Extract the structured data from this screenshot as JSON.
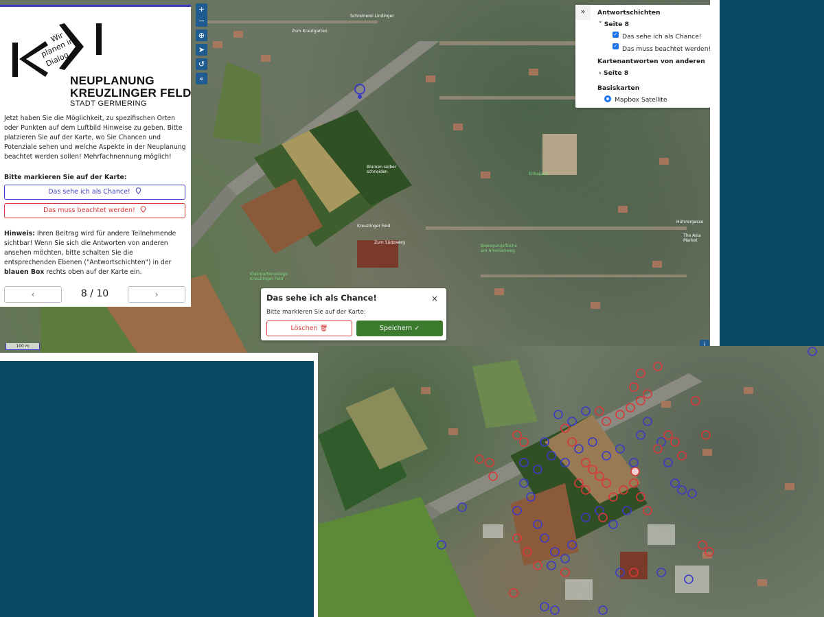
{
  "logo": {
    "words": [
      "Wir",
      "planen im",
      "Dialog"
    ],
    "title_line1": "NEUPLANUNG",
    "title_line2": "KREUZLINGER FELD",
    "title_line3": "STADT GERMERING"
  },
  "panel": {
    "intro": "Jetzt haben Sie die Möglichkeit, zu spezifischen Orten oder Punkten auf dem Luftbild Hinweise zu geben. Bitte platzieren Sie auf der Karte, wo Sie Chancen und Potenziale sehen und welche Aspekte in der Neuplanung beachtet werden sollen! Mehrfachnennung möglich!",
    "mark_heading": "Bitte markieren Sie auf der Karte:",
    "btn_chance": "Das sehe ich als Chance!",
    "btn_attention": "Das muss beachtet werden!",
    "hint_label": "Hinweis:",
    "hint_text_1": " Ihren Beitrag wird für andere Teilnehmende sichtbar! Wenn Sie sich die Antworten von anderen ansehen möchten, bitte schalten Sie die entsprechenden Ebenen (\"Antwortschichten\") in der ",
    "hint_bold": "blauen Box",
    "hint_text_2": " rechts oben auf der Karte ein.",
    "page": "8 / 10"
  },
  "layers": {
    "heading_answers": "Antwortschichten",
    "group_page": "Seite 8",
    "item_chance": "Das sehe ich als Chance!",
    "item_attention": "Das muss beachtet werden!",
    "heading_others": "Kartenantworten von anderen",
    "others_page": "Seite 8",
    "heading_base": "Basiskarten",
    "base_item": "Mapbox Satellite",
    "toggle": "»"
  },
  "popup": {
    "title": "Das sehe ich als Chance!",
    "subtitle": "Bitte markieren Sie auf der Karte:",
    "delete": "Löschen",
    "save": "Speichern",
    "close": "×"
  },
  "map": {
    "scale": "100 m",
    "labels": [
      "Zum Krautgarten",
      "Schreinerei Lindinger",
      "Blumen selber schneiden",
      "Zum Südzwerg",
      "Kreuzlinger Feld",
      "Erikapark",
      "Bewegungsfläche am Ameisenweg",
      "Kleingartenanlage Kreuzlinger Feld",
      "Hühnergasse",
      "The Asia Market"
    ],
    "info": "i"
  },
  "colors": {
    "chance": "#3b3bc4",
    "attention": "#d93838",
    "save": "#3c7a2e",
    "control": "#1f5b8f"
  }
}
